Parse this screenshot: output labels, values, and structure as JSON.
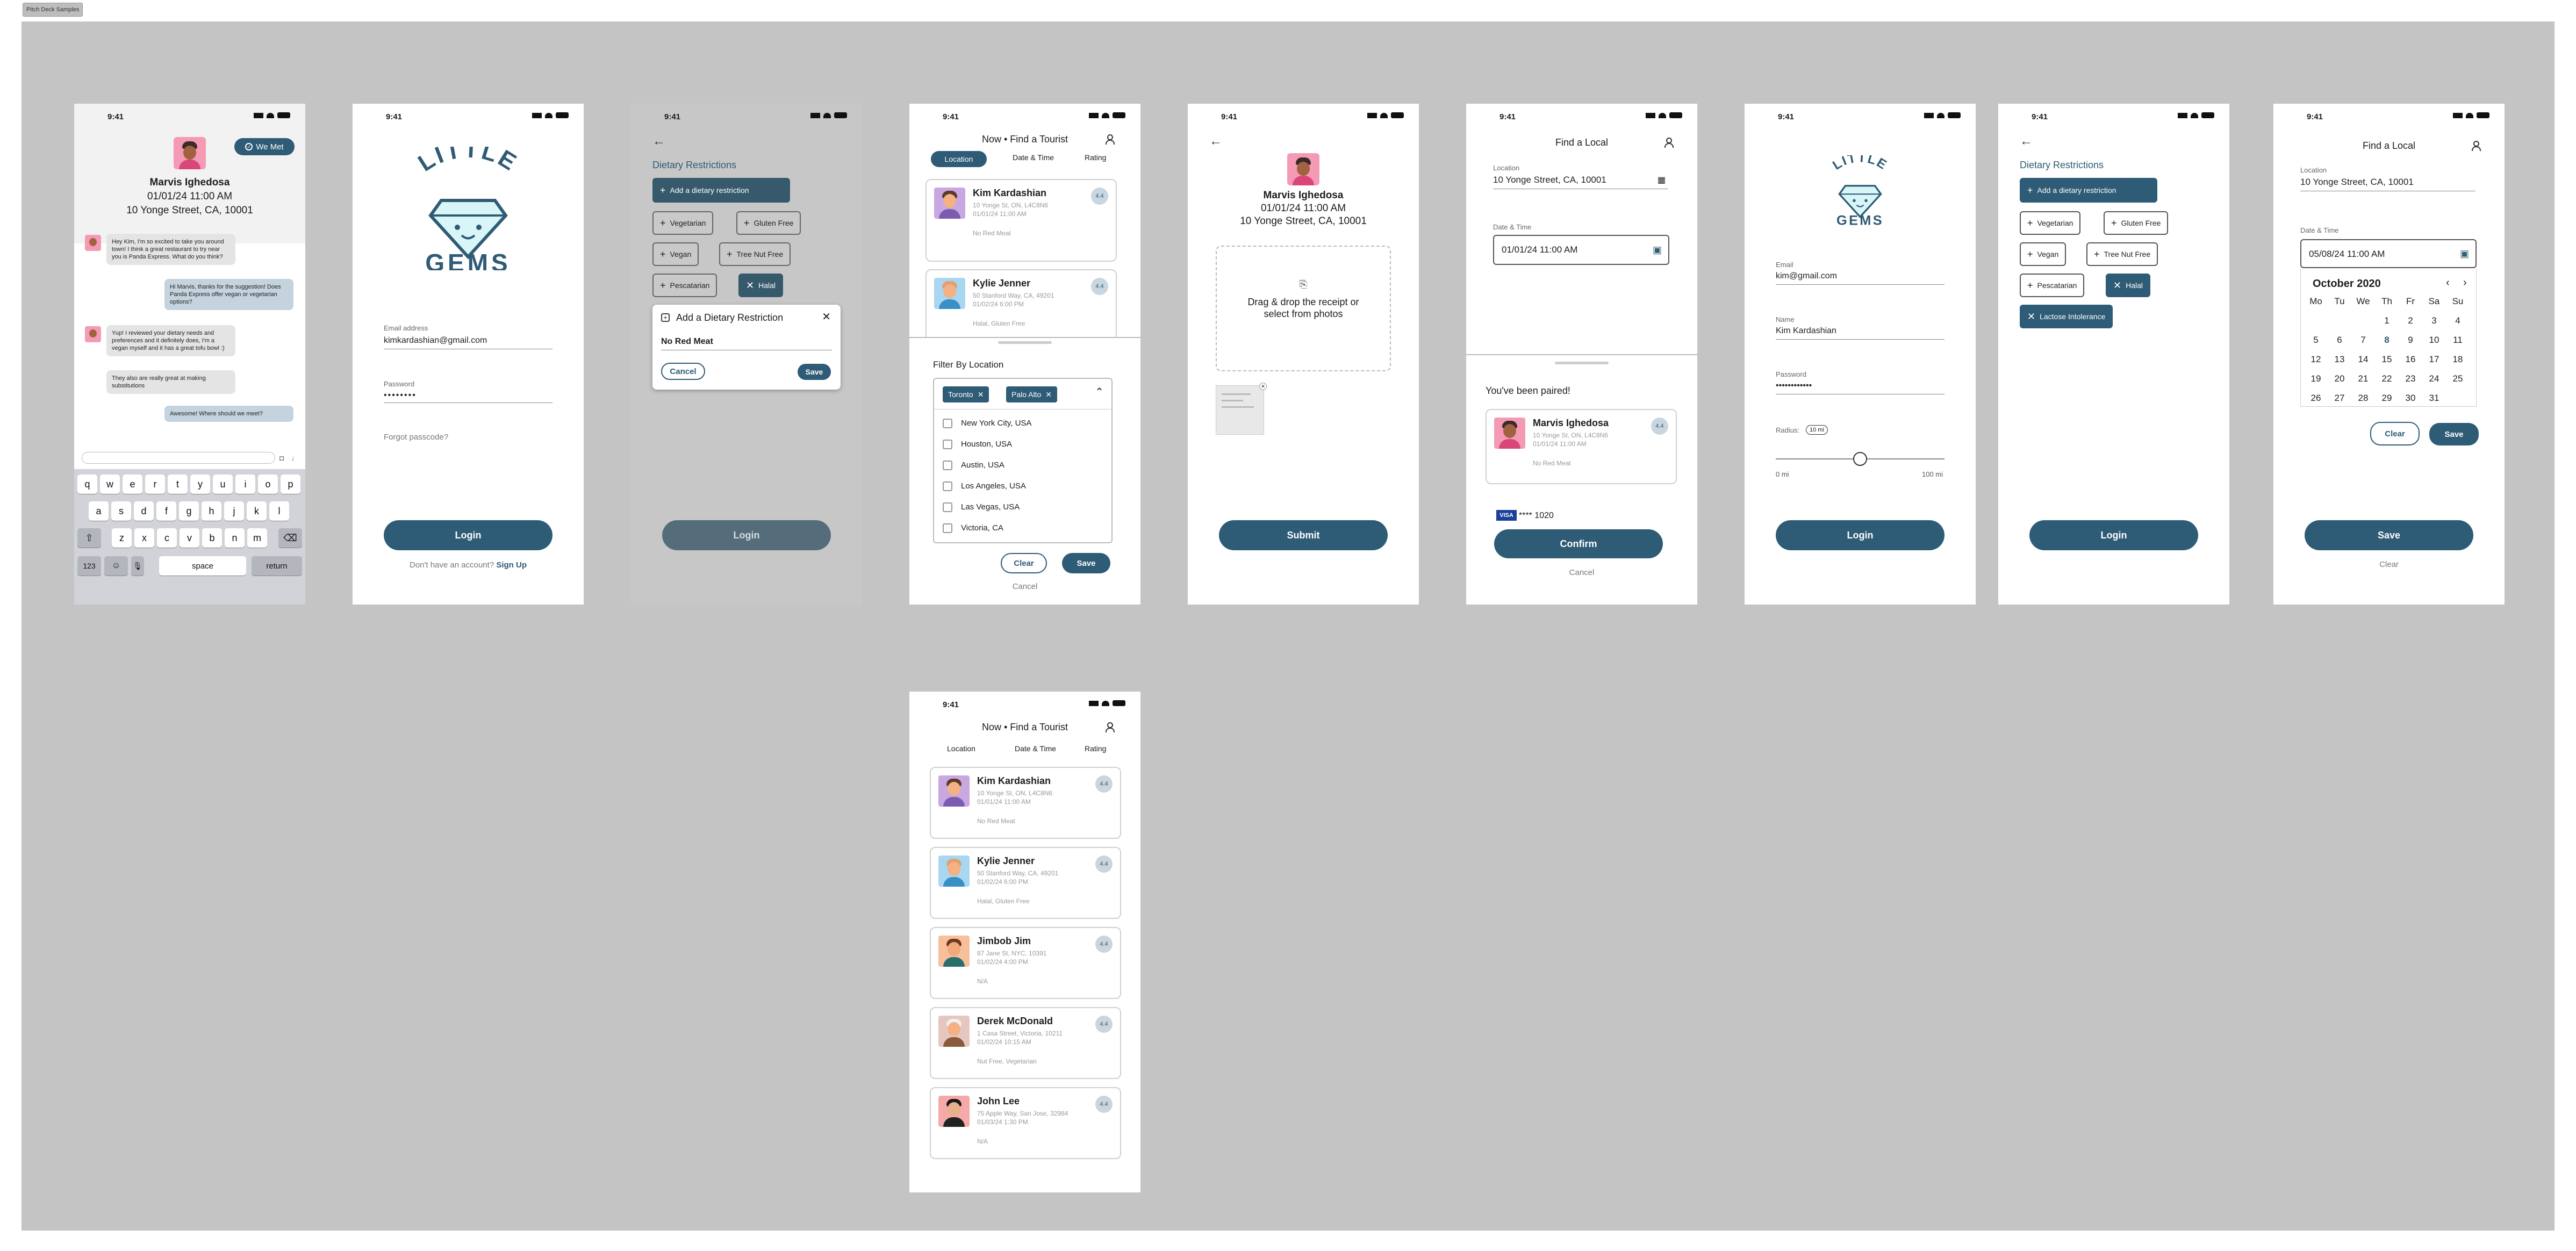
{
  "page_tag": "Pitch Deck Samples",
  "status_time": "9:41",
  "chat": {
    "we_met": "We Met",
    "name": "Marvis Ighedosa",
    "datetime": "01/01/24 11:00 AM",
    "address": "10 Yonge Street, CA, 10001",
    "messages": [
      "Hey Kim, I'm so excited to take you around town! I think a great restaurant to try near you is Panda Express. What do you think?",
      "Hi Marvis, thanks for the suggestion! Does Panda Express offer vegan or vegetarian options?",
      "Yup! I reviewed your dietary needs and preferences and it definitely does, I'm a vegan myself and it has a great tofu bowl :)",
      "They also are really great at making substitutions",
      "Awesome! Where should we meet?"
    ],
    "keyboard": {
      "row1": [
        "q",
        "w",
        "e",
        "r",
        "t",
        "y",
        "u",
        "i",
        "o",
        "p"
      ],
      "row2": [
        "a",
        "s",
        "d",
        "f",
        "g",
        "h",
        "j",
        "k",
        "l"
      ],
      "row3": [
        "z",
        "x",
        "c",
        "v",
        "b",
        "n",
        "m"
      ],
      "num": "123",
      "space": "space",
      "ret": "return",
      "shift": "⇧",
      "del": "⌫",
      "emoji": "☺",
      "mic": "🎙"
    }
  },
  "logo": {
    "top": "LITTLE",
    "bottom": "GEMS"
  },
  "login1": {
    "email_label": "Email address",
    "email_value": "kimkardashian@gmail.com",
    "password_label": "Password",
    "password_value": "••••••••",
    "forgot": "Forgot passcode?",
    "login": "Login",
    "no_account": "Don't have an account?",
    "signup": "Sign Up"
  },
  "dietary_modal": {
    "title": "Dietary Restrictions",
    "add": "Add a dietary restriction",
    "chips": [
      "Vegetarian",
      "Gluten Free",
      "Vegan",
      "Tree Nut Free",
      "Pescatarian",
      "Halal"
    ],
    "modal_title": "Add a Dietary Restriction",
    "modal_value": "No Red Meat",
    "cancel": "Cancel",
    "save": "Save",
    "login": "Login"
  },
  "filter": {
    "header": "Now • Find a Tourist",
    "tabs": [
      "Location",
      "Date & Time",
      "Rating"
    ],
    "sheet_title": "Filter By Location",
    "selected": [
      "Toronto",
      "Palo Alto"
    ],
    "options": [
      "New York City, USA",
      "Houston, USA",
      "Austin, USA",
      "Los Angeles, USA",
      "Las Vegas, USA",
      "Victoria, CA"
    ],
    "clear": "Clear",
    "save": "Save",
    "cancel": "Cancel"
  },
  "tourists": [
    {
      "name": "Kim Kardashian",
      "address": "10 Yonge St, ON, L4C8N6",
      "datetime": "01/01/24 11:00 AM",
      "tags": "No Red Meat",
      "rating": "4.4"
    },
    {
      "name": "Kylie Jenner",
      "address": "50 Stanford Way, CA, 49201",
      "datetime": "01/02/24 6:00 PM",
      "tags": "Halal, Gluten Free",
      "rating": "4.4"
    },
    {
      "name": "Jimbob Jim",
      "address": "87 Jane St, NYC, 10391",
      "datetime": "01/02/24 4:00 PM",
      "tags": "N/A",
      "rating": "4.4"
    },
    {
      "name": "Derek McDonald",
      "address": "1 Casa Street, Victoria, 10211",
      "datetime": "01/02/24 10:15 AM",
      "tags": "Nut Free, Vegetarian",
      "rating": "4.4"
    },
    {
      "name": "John Lee",
      "address": "75 Apple Way, San Jose, 32984",
      "datetime": "01/03/24 1:30 PM",
      "tags": "N/A",
      "rating": "4.4"
    }
  ],
  "receipt": {
    "name": "Marvis Ighedosa",
    "datetime": "01/01/24 11:00 AM",
    "address": "10 Yonge Street, CA, 10001",
    "drop_text": "Drag & drop the receipt or select from photos",
    "submit": "Submit"
  },
  "paired": {
    "title": "Find a Local",
    "location_label": "Location",
    "location_value": "10 Yonge Street, CA, 10001",
    "dt_label": "Date & Time",
    "dt_value": "01/01/24 11:00 AM",
    "heading": "You've been paired!",
    "card_name": "Marvis Ighedosa",
    "card_address": "10 Yonge St, ON, L4C8N6",
    "card_datetime": "01/01/24 11:00 AM",
    "card_tags": "No Red Meat",
    "card_rating": "4.4",
    "visa": "VISA",
    "card_number": "**** 1020",
    "confirm": "Confirm",
    "cancel": "Cancel"
  },
  "signup": {
    "email_label": "Email",
    "email_value": "kim@gmail.com",
    "name_label": "Name",
    "name_value": "Kim Kardashian",
    "password_label": "Password",
    "password_value": "••••••••••••",
    "radius_label": "Radius:",
    "radius_value": "10 mi",
    "min": "0 mi",
    "max": "100 mi",
    "radius_fraction": 0.5,
    "login": "Login"
  },
  "dietary2": {
    "title": "Dietary Restrictions",
    "add": "Add a dietary restriction",
    "chips": [
      "Vegetarian",
      "Gluten Free",
      "Vegan",
      "Tree Nut Free",
      "Pescatarian",
      "Halal",
      "Lactose Intolerance"
    ],
    "login": "Login"
  },
  "calendar": {
    "title": "Find a Local",
    "location_label": "Location",
    "location_value": "10 Yonge Street, CA, 10001",
    "dt_label": "Date & Time",
    "dt_value": "05/08/24 11:00 AM",
    "month": "October 2020",
    "weekdays": [
      "Mo",
      "Tu",
      "We",
      "Th",
      "Fr",
      "Sa",
      "Su"
    ],
    "weeks": [
      [
        "",
        "",
        "",
        "1",
        "2",
        "3",
        "4"
      ],
      [
        "5",
        "6",
        "7",
        "8",
        "9",
        "10",
        "11"
      ],
      [
        "12",
        "13",
        "14",
        "15",
        "16",
        "17",
        "18"
      ],
      [
        "19",
        "20",
        "21",
        "22",
        "23",
        "24",
        "25"
      ],
      [
        "26",
        "27",
        "28",
        "29",
        "30",
        "31",
        ""
      ]
    ],
    "today": "8",
    "clear": "Clear",
    "save": "Save",
    "save_big": "Save",
    "clear_big": "Clear"
  },
  "colors": {
    "primary": "#2e5b75",
    "canvas": "#c4c4c4",
    "chip_selected": "#2e5b75"
  }
}
